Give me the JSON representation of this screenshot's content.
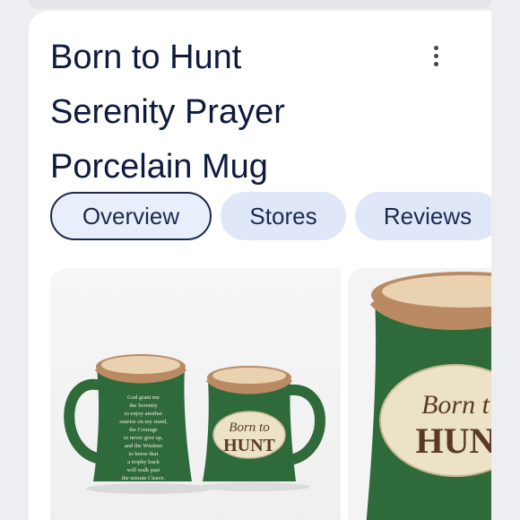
{
  "product": {
    "title_lines": [
      "Born to Hunt",
      "Serenity Prayer",
      "Porcelain Mug"
    ]
  },
  "menu_icon": "more-vert-icon",
  "tabs": [
    {
      "label": "Overview",
      "active": true
    },
    {
      "label": "Stores",
      "active": false
    },
    {
      "label": "Reviews",
      "active": false
    }
  ],
  "images": {
    "left_mug_text": [
      "God grant me",
      "the Serenity",
      "to enjoy another",
      "sunrise on my stand,",
      "the Courage",
      "to never give up,",
      "and the Wisdom",
      "to know that",
      "a trophy buck",
      "will walk past",
      "the minute I leave."
    ],
    "mug_label_line1": "Born to",
    "mug_label_line2": "HUNT",
    "zoom_label_line1": "Born t",
    "zoom_label_line2": "HUN"
  },
  "colors": {
    "mug_green": "#2f6a3a",
    "mug_rim": "#b98a63",
    "mug_interior": "#e8d2b0",
    "label_cream": "#ece2c8",
    "label_text": "#5a3a22",
    "title_text": "#0f1b3d",
    "tab_bg": "#dfe7f8"
  }
}
